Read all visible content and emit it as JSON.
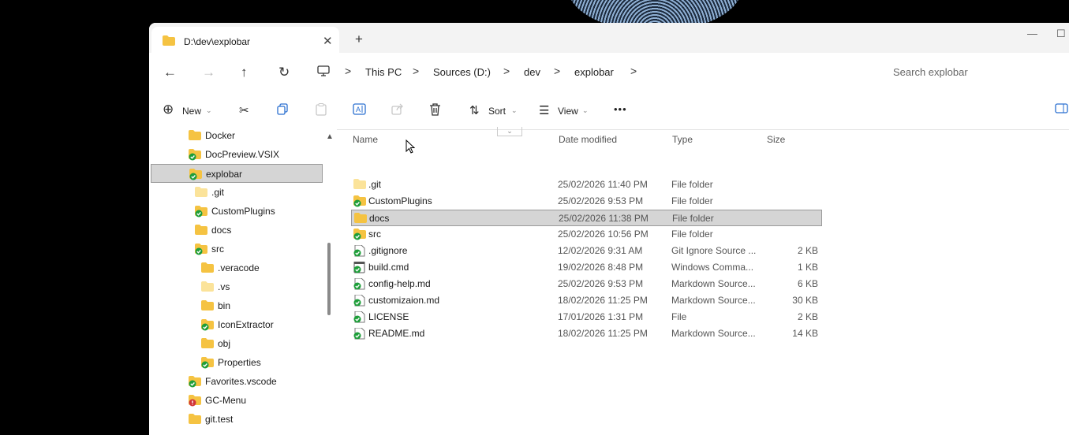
{
  "tab": {
    "title": "D:\\dev\\explobar",
    "close": "✕",
    "new": "+"
  },
  "window_controls": {
    "minimize": "—",
    "maximize": "☐"
  },
  "nav": {
    "back": "←",
    "forward": "→",
    "up": "↑",
    "refresh": "↻",
    "breadcrumb": [
      "This PC",
      "Sources (D:)",
      "dev",
      "explobar"
    ],
    "separator": ">",
    "search_placeholder": "Search explobar"
  },
  "toolbar": {
    "new_label": "New",
    "sort_label": "Sort",
    "view_label": "View",
    "more": "•••"
  },
  "tree": [
    {
      "label": "Docker",
      "icon": "folder",
      "status": "none"
    },
    {
      "label": "DocPreview.VSIX",
      "icon": "folder",
      "status": "ok"
    },
    {
      "label": "explobar",
      "icon": "folder",
      "status": "ok",
      "selected": true
    },
    {
      "label": ".git",
      "icon": "folder-light",
      "status": "none"
    },
    {
      "label": "CustomPlugins",
      "icon": "folder",
      "status": "ok"
    },
    {
      "label": "docs",
      "icon": "folder",
      "status": "none"
    },
    {
      "label": "src",
      "icon": "folder",
      "status": "ok"
    },
    {
      "label": ".veracode",
      "icon": "folder",
      "status": "none"
    },
    {
      "label": ".vs",
      "icon": "folder-light",
      "status": "none"
    },
    {
      "label": "bin",
      "icon": "folder",
      "status": "none"
    },
    {
      "label": "IconExtractor",
      "icon": "folder",
      "status": "ok"
    },
    {
      "label": "obj",
      "icon": "folder",
      "status": "none"
    },
    {
      "label": "Properties",
      "icon": "folder",
      "status": "ok"
    },
    {
      "label": "Favorites.vscode",
      "icon": "folder",
      "status": "ok"
    },
    {
      "label": "GC-Menu",
      "icon": "folder",
      "status": "error"
    },
    {
      "label": "git.test",
      "icon": "folder",
      "status": "none"
    }
  ],
  "columns": {
    "name": "Name",
    "date": "Date modified",
    "type": "Type",
    "size": "Size"
  },
  "files": [
    {
      "name": ".git",
      "date": "25/02/2026 11:40 PM",
      "type": "File folder",
      "size": "",
      "icon": "folder-light",
      "status": "none"
    },
    {
      "name": "CustomPlugins",
      "date": "25/02/2026 9:53 PM",
      "type": "File folder",
      "size": "",
      "icon": "folder",
      "status": "ok"
    },
    {
      "name": "docs",
      "date": "25/02/2026 11:38 PM",
      "type": "File folder",
      "size": "",
      "icon": "folder",
      "status": "none",
      "selected": true
    },
    {
      "name": "src",
      "date": "25/02/2026 10:56 PM",
      "type": "File folder",
      "size": "",
      "icon": "folder",
      "status": "ok"
    },
    {
      "name": ".gitignore",
      "date": "12/02/2026 9:31 AM",
      "type": "Git Ignore Source ...",
      "size": "2 KB",
      "icon": "file",
      "status": "ok"
    },
    {
      "name": "build.cmd",
      "date": "19/02/2026 8:48 PM",
      "type": "Windows Comma...",
      "size": "1 KB",
      "icon": "cmd",
      "status": "ok"
    },
    {
      "name": "config-help.md",
      "date": "25/02/2026 9:53 PM",
      "type": "Markdown Source...",
      "size": "6 KB",
      "icon": "file",
      "status": "ok"
    },
    {
      "name": "customizaion.md",
      "date": "18/02/2026 11:25 PM",
      "type": "Markdown Source...",
      "size": "30 KB",
      "icon": "file",
      "status": "ok"
    },
    {
      "name": "LICENSE",
      "date": "17/01/2026 1:31 PM",
      "type": "File",
      "size": "2 KB",
      "icon": "file",
      "status": "ok"
    },
    {
      "name": "README.md",
      "date": "18/02/2026 11:25 PM",
      "type": "Markdown Source...",
      "size": "14 KB",
      "icon": "file",
      "status": "ok"
    }
  ],
  "colors": {
    "folder": "#f5c342",
    "folder_light": "#fbe39a",
    "ok": "#1e9e3a",
    "error": "#d13438",
    "selection": "#d5d5d5"
  }
}
